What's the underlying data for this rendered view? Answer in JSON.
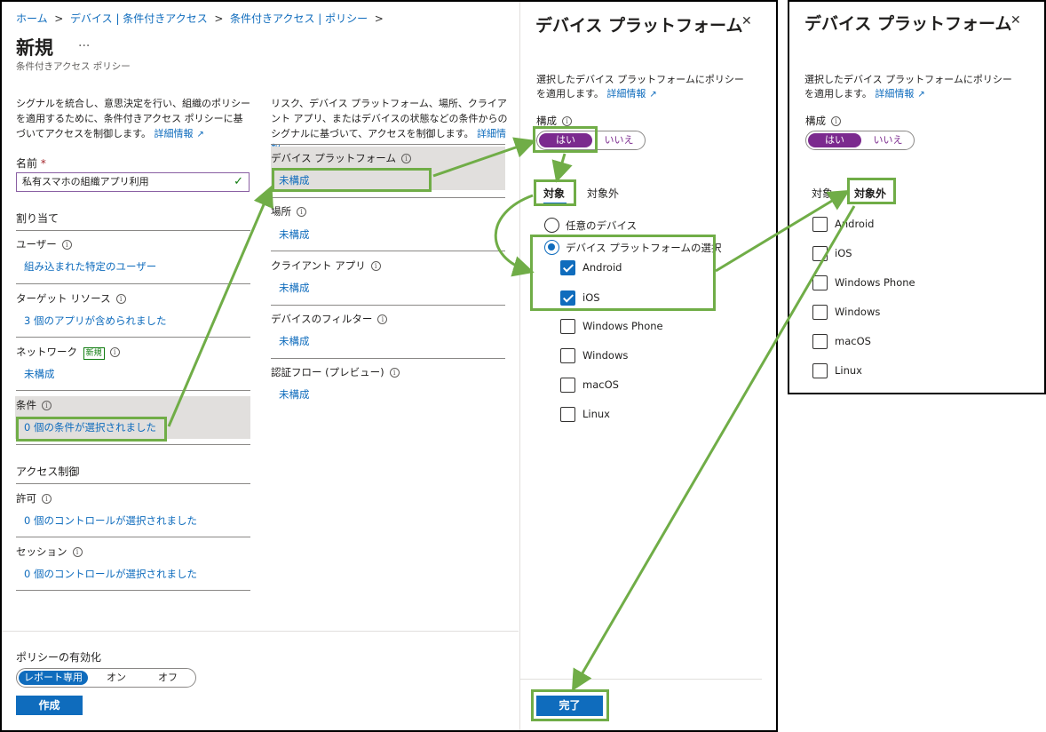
{
  "breadcrumb": [
    "ホーム",
    "デバイス | 条件付きアクセス",
    "条件付きアクセス | ポリシー"
  ],
  "page": {
    "title": "新規",
    "more": "...",
    "subtitle": "条件付きアクセス ポリシー",
    "intro": "シグナルを統合し、意思決定を行い、組織のポリシーを適用するために、条件付きアクセス ポリシーに基づいてアクセスを制御します。",
    "learn_more": "詳細情報"
  },
  "name_field": {
    "label": "名前",
    "required": "*",
    "value": "私有スマホの組織アプリ利用"
  },
  "assignments": {
    "heading": "割り当て",
    "items": [
      {
        "label": "ユーザー",
        "value": "組み込まれた特定のユーザー"
      },
      {
        "label": "ターゲット リソース",
        "value": "3 個のアプリが含められました"
      },
      {
        "label": "ネットワーク",
        "badge": "新規",
        "value": "未構成"
      },
      {
        "label": "条件",
        "value": "0 個の条件が選択されました"
      }
    ]
  },
  "access_controls": {
    "heading": "アクセス制御",
    "items": [
      {
        "label": "許可",
        "value": "0 個のコントロールが選択されました"
      },
      {
        "label": "セッション",
        "value": "0 個のコントロールが選択されました"
      }
    ]
  },
  "conditions": {
    "intro": "リスク、デバイス プラットフォーム、場所、クライアント アプリ、またはデバイスの状態などの条件からのシグナルに基づいて、アクセスを制御します。",
    "learn_more": "詳細情報",
    "items": [
      {
        "label": "デバイス プラットフォーム",
        "value": "未構成"
      },
      {
        "label": "場所",
        "value": "未構成"
      },
      {
        "label": "クライアント アプリ",
        "value": "未構成"
      },
      {
        "label": "デバイスのフィルター",
        "value": "未構成"
      },
      {
        "label": "認証フロー (プレビュー)",
        "value": "未構成"
      }
    ]
  },
  "footer": {
    "enable_label": "ポリシーの有効化",
    "options": [
      "レポート専用",
      "オン",
      "オフ"
    ],
    "create": "作成"
  },
  "panel": {
    "title": "デバイス プラットフォーム",
    "close": "✕",
    "desc": "選択したデバイス プラットフォームにポリシーを適用します。",
    "learn_more": "詳細情報",
    "config_label": "構成",
    "yes": "はい",
    "no": "いいえ",
    "tab_include": "対象",
    "tab_exclude": "対象外",
    "any_device": "任意のデバイス",
    "select_platforms": "デバイス プラットフォームの選択",
    "platforms": [
      "Android",
      "iOS",
      "Windows Phone",
      "Windows",
      "macOS",
      "Linux"
    ],
    "checked": [
      true,
      true,
      false,
      false,
      false,
      false
    ],
    "done": "完了"
  },
  "panel2": {
    "title": "デバイス プラットフォーム",
    "close": "✕",
    "desc": "選択したデバイス プラットフォームにポリシーを適用します。",
    "learn_more": "詳細情報",
    "config_label": "構成",
    "yes": "はい",
    "no": "いいえ",
    "tab_include": "対象",
    "tab_exclude": "対象外",
    "platforms": [
      "Android",
      "iOS",
      "Windows Phone",
      "Windows",
      "macOS",
      "Linux"
    ]
  },
  "colors": {
    "accent": "#0f6cbd",
    "purple": "#7b2a8e",
    "highlight": "#70ad47"
  }
}
